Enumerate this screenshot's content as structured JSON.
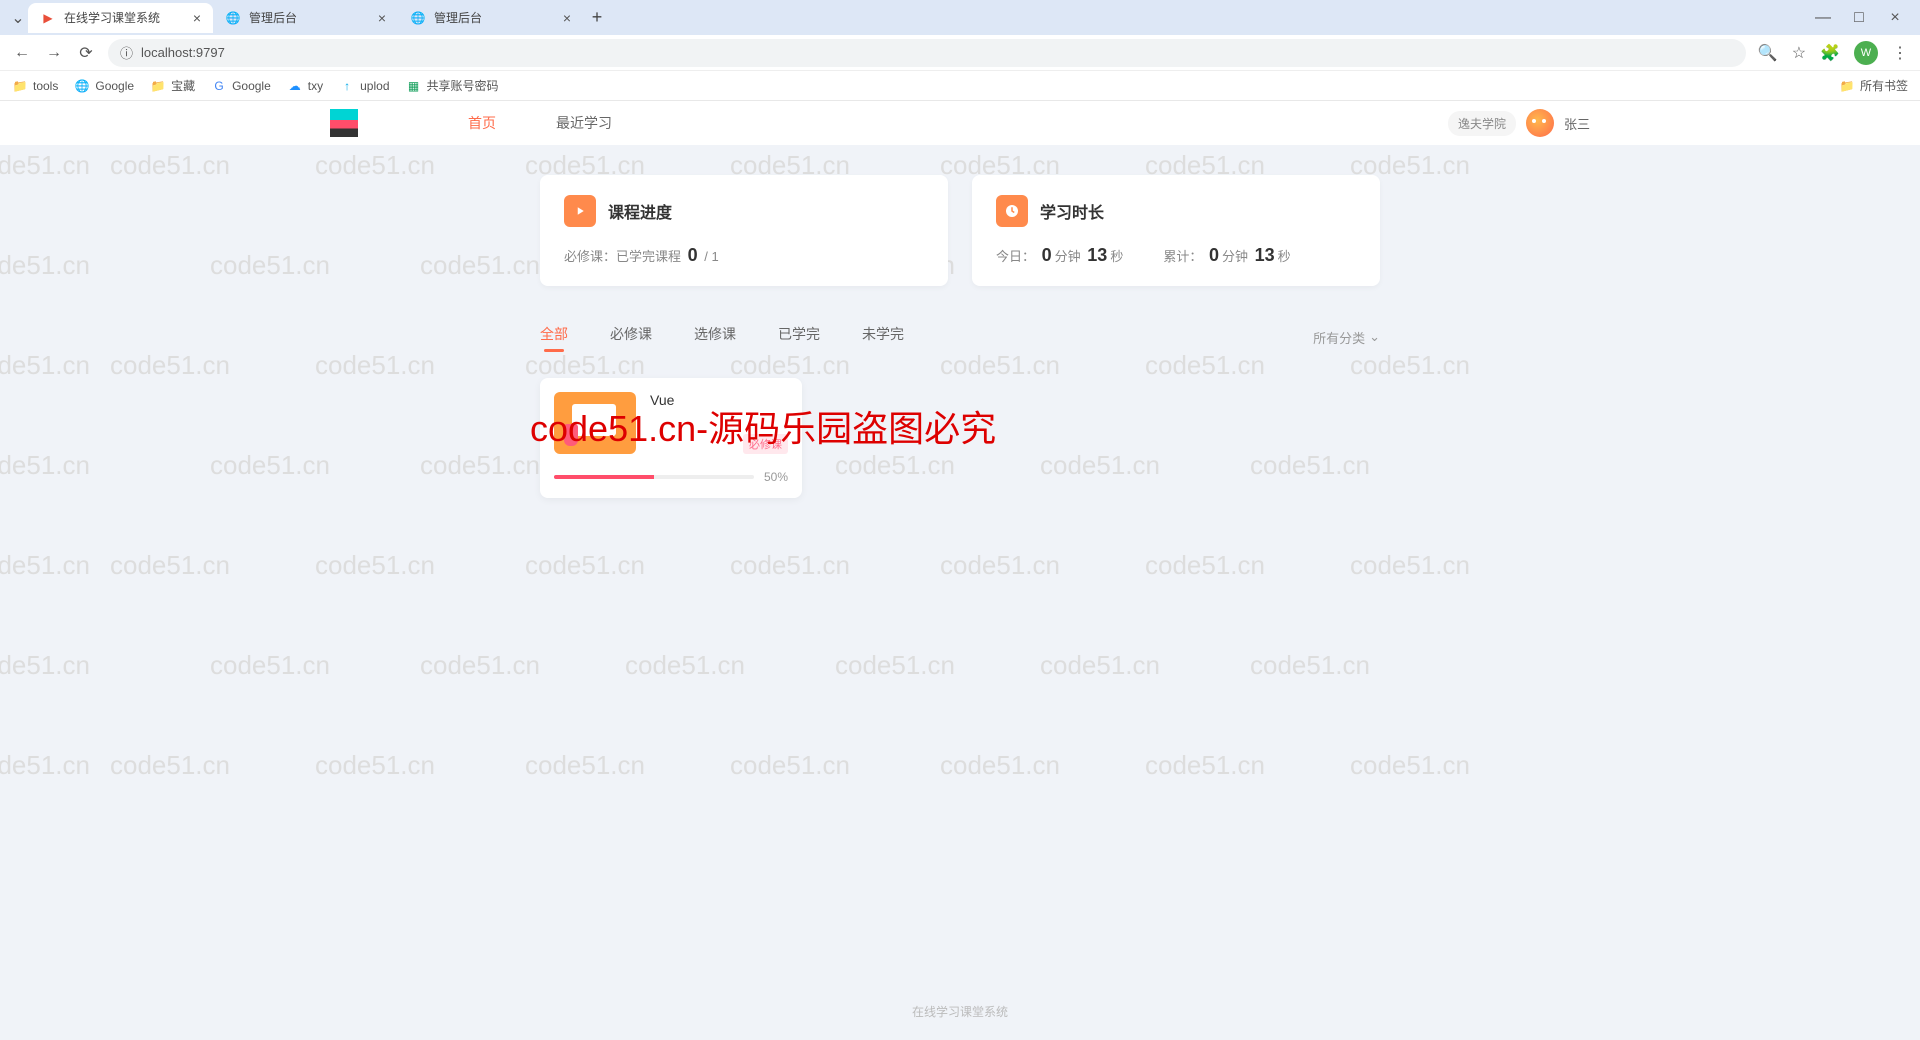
{
  "browser": {
    "tabs": [
      {
        "title": "在线学习课堂系统",
        "active": true
      },
      {
        "title": "管理后台",
        "active": false
      },
      {
        "title": "管理后台",
        "active": false
      }
    ],
    "url": "localhost:9797",
    "bookmarks": [
      "tools",
      "Google",
      "宝藏",
      "Google",
      "txy",
      "uplod",
      "共享账号密码"
    ],
    "all_bookmarks": "所有书签",
    "profile_letter": "W"
  },
  "header": {
    "nav": {
      "home": "首页",
      "recent": "最近学习"
    },
    "college": "逸夫学院",
    "username": "张三"
  },
  "stats": {
    "progress": {
      "title": "课程进度",
      "label_prefix": "必修课：已学完课程",
      "done": "0",
      "sep": "/",
      "total": "1"
    },
    "duration": {
      "title": "学习时长",
      "today_label": "今日：",
      "today_min": "0",
      "min_unit": "分钟",
      "today_sec": "13",
      "sec_unit": "秒",
      "total_label": "累计：",
      "total_min": "0",
      "total_sec": "13"
    }
  },
  "filters": {
    "tabs": [
      "全部",
      "必修课",
      "选修课",
      "已学完",
      "未学完"
    ],
    "category": "所有分类"
  },
  "course": {
    "name": "Vue",
    "badge": "必修课",
    "progress_pct": "50%",
    "progress_val": 50
  },
  "watermark": {
    "text": "code51.cn",
    "red": "code51.cn-源码乐园盗图必究"
  },
  "footer": "在线学习课堂系统"
}
